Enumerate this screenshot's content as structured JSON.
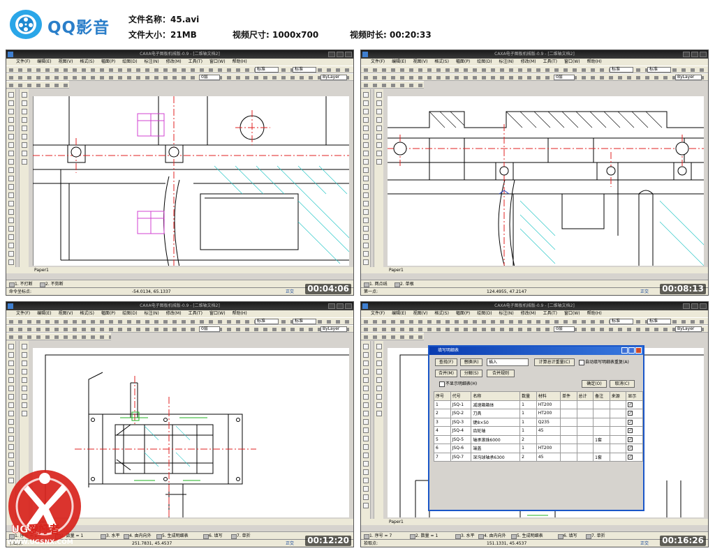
{
  "header": {
    "app_name": "QQ影音",
    "file_name": "文件名称：45.avi",
    "file_size": "文件大小：21MB",
    "video_size": "视频尺寸: 1000x700",
    "video_duration": "视频时长: 00:20:33"
  },
  "cad": {
    "title": "CAXA电子图板机械版-0.9 - [二维轴文档2]",
    "menu": [
      "文件(F)",
      "编辑(E)",
      "视图(V)",
      "格式(S)",
      "幅面(P)",
      "绘图(D)",
      "标注(N)",
      "修改(M)",
      "工具(T)",
      "窗口(W)",
      "帮助(H)"
    ],
    "layer_box": "标准",
    "style_box": "标准",
    "layer_name": "0层",
    "linetype": "ByLayer",
    "sheet_tab": "Paper1"
  },
  "frames": [
    {
      "timestamp": "00:04:06",
      "cmd": [
        "1. 不打断",
        "2. 不剪断"
      ],
      "status_left": "命令坐标点:",
      "status_mid": "-54.0134, 65.1337",
      "status_ctx": "正交"
    },
    {
      "timestamp": "00:08:13",
      "cmd": [
        "1. 两点线",
        "2. 单根"
      ],
      "status_left": "第一点:",
      "status_mid": "124.4955, 47.2147",
      "status_ctx": "正交"
    },
    {
      "timestamp": "00:12:20",
      "cmd": [
        "1. 序号 = 1",
        "2. 数量 = 1",
        "3. 水平",
        "4. 由内向外",
        "5. 生成明细表",
        "6. 填写",
        "7. 单折"
      ],
      "status_left": "引出点:",
      "status_mid": "251.7831, 45.4537",
      "status_ctx": "正交"
    },
    {
      "timestamp": "00:16:26",
      "cmd": [
        "1. 序号 = 7",
        "2. 数量 = 1",
        "3. 水平",
        "4. 由内向外",
        "5. 生成明细表",
        "6. 填写",
        "7. 单折"
      ],
      "status_left": "拾取点:",
      "status_mid": "151.1331, 45.4537",
      "status_ctx": "正交"
    }
  ],
  "dialog": {
    "title": "填写明细表",
    "buttons": [
      "查找(F)",
      "替换(R)",
      "合并(M)",
      "分解(S)",
      "合并规则",
      "计算总计重量(C)",
      "确定(O)",
      "取消(C)"
    ],
    "insert_label": "插入",
    "check_auto": "自动填写明细表重复(A)",
    "check_hide": "不显示明细表(H)",
    "columns": [
      "序号",
      "代号",
      "名称",
      "数量",
      "材料",
      "单件",
      "总计",
      "备注",
      "来源",
      "显示"
    ],
    "rows": [
      [
        "1",
        "JSQ-1",
        "减速箱箱体",
        "1",
        "HT200",
        "",
        "",
        "",
        "",
        "✓"
      ],
      [
        "2",
        "JSQ-2",
        "刀具",
        "1",
        "HT200",
        "",
        "",
        "",
        "",
        "✓"
      ],
      [
        "3",
        "JSQ-3",
        "键8×50",
        "1",
        "Q235",
        "",
        "",
        "",
        "",
        "✓"
      ],
      [
        "4",
        "JSQ-4",
        "齿轮轴",
        "1",
        "45",
        "",
        "",
        "",
        "",
        "✓"
      ],
      [
        "5",
        "JSQ-5",
        "轴承滚珠6000",
        "2",
        "",
        "",
        "",
        "1套",
        "",
        "✓"
      ],
      [
        "6",
        "JSQ-6",
        "端盖",
        "1",
        "HT200",
        "",
        "",
        "",
        "",
        "✓"
      ],
      [
        "7",
        "JSQ-7",
        "深沟球轴承6300",
        "2",
        "45",
        "",
        "",
        "1套",
        "",
        "✓"
      ]
    ]
  },
  "watermark": {
    "brand": "UG爱好者",
    "url": "WWW.UGSNX.COM"
  },
  "colors": {
    "accent_blue": "#2a7ec9",
    "cad_red_centerline": "#e02020",
    "cad_hatch_cyan": "#2ac8c8",
    "cad_magenta": "#d040d0",
    "watermark_red": "#d8231c"
  }
}
